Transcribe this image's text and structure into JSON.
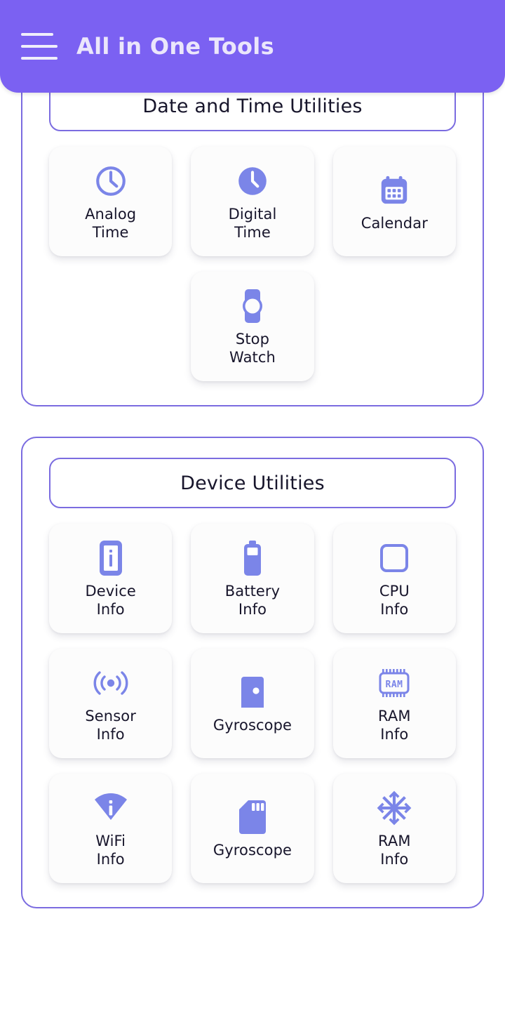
{
  "app": {
    "title": "All in One Tools",
    "menu_icon": "hamburger-menu-icon",
    "accent_color": "#7b61f2",
    "card_border_color": "#7b6ce0",
    "icon_color": "#7b85e8",
    "text_color": "#17152b"
  },
  "sections": [
    {
      "id": "date-and-time-utilities",
      "title": "Date and Time Utilities",
      "tiles": [
        {
          "label": "Analog\nTime",
          "icon": "analog-clock-icon"
        },
        {
          "label": "Digital\nTime",
          "icon": "digital-clock-icon"
        },
        {
          "label": "Calendar",
          "icon": "calendar-icon"
        },
        {
          "label": "Stop\nWatch",
          "icon": "stopwatch-watch-icon"
        }
      ]
    },
    {
      "id": "device-utilities",
      "title": "Device Utilities",
      "tiles": [
        {
          "label": "Device\nInfo",
          "icon": "phone-info-icon"
        },
        {
          "label": "Battery\nInfo",
          "icon": "battery-icon"
        },
        {
          "label": "CPU\nInfo",
          "icon": "cpu-square-icon"
        },
        {
          "label": "Sensor\nInfo",
          "icon": "sensor-broadcast-icon"
        },
        {
          "label": "Gyroscope",
          "icon": "gyroscope-icon"
        },
        {
          "label": "RAM\nInfo",
          "icon": "ram-chip-icon"
        },
        {
          "label": "WiFi\nInfo",
          "icon": "wifi-info-icon"
        },
        {
          "label": "Gyroscope",
          "icon": "sd-card-icon"
        },
        {
          "label": "RAM\nInfo",
          "icon": "snowflake-icon"
        }
      ]
    }
  ]
}
